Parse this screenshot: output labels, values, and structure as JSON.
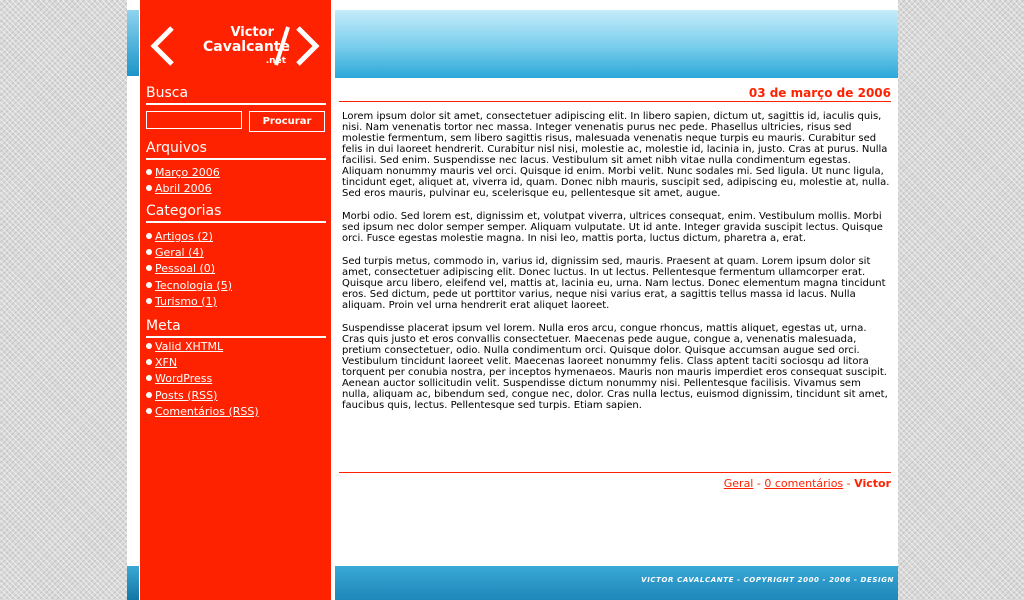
{
  "logo": {
    "line1": "Victor",
    "line2": "Cavalcante",
    "line3": ".net"
  },
  "sidebar": {
    "search_title": "Busca",
    "search_button": "Procurar",
    "archives_title": "Arquivos",
    "archives": [
      "Março 2006",
      "Abril 2006"
    ],
    "categories_title": "Categorias",
    "categories": [
      "Artigos (2)",
      "Geral (4)",
      "Pessoal (0)",
      "Tecnologia (5)",
      "Turismo (1)"
    ],
    "meta_title": "Meta",
    "meta": [
      "Valid XHTML",
      "XFN",
      "WordPress",
      "Posts (RSS)",
      "Comentários (RSS)"
    ]
  },
  "post": {
    "date": "03 de março de 2006",
    "paragraphs": [
      "Lorem ipsum dolor sit amet, consectetuer adipiscing elit. In libero sapien, dictum ut, sagittis id, iaculis quis, nisi. Nam venenatis tortor nec massa. Integer venenatis purus nec pede. Phasellus ultricies, risus sed molestie fermentum, sem libero sagittis risus, malesuada venenatis neque turpis eu mauris. Curabitur sed felis in dui laoreet hendrerit. Curabitur nisl nisi, molestie ac, molestie id, lacinia in, justo. Cras at purus. Nulla facilisi. Sed enim. Suspendisse nec lacus. Vestibulum sit amet nibh vitae nulla condimentum egestas. Aliquam nonummy mauris vel orci. Quisque id enim. Morbi velit. Nunc sodales mi. Sed ligula. Ut nunc ligula, tincidunt eget, aliquet at, viverra id, quam. Donec nibh mauris, suscipit sed, adipiscing eu, molestie at, nulla. Sed eros mauris, pulvinar eu, scelerisque eu, pellentesque sit amet, augue.",
      "Morbi odio. Sed lorem est, dignissim et, volutpat viverra, ultrices consequat, enim. Vestibulum mollis. Morbi sed ipsum nec dolor semper semper. Aliquam vulputate. Ut id ante. Integer gravida suscipit lectus. Quisque orci. Fusce egestas molestie magna. In nisi leo, mattis porta, luctus dictum, pharetra a, erat.",
      "Sed turpis metus, commodo in, varius id, dignissim sed, mauris. Praesent at quam. Lorem ipsum dolor sit amet, consectetuer adipiscing elit. Donec luctus. In ut lectus. Pellentesque fermentum ullamcorper erat. Quisque arcu libero, eleifend vel, mattis at, lacinia eu, urna. Nam lectus. Donec elementum magna tincidunt eros. Sed dictum, pede ut porttitor varius, neque nisi varius erat, a sagittis tellus massa id lacus. Nulla aliquam. Proin vel urna hendrerit erat aliquet laoreet.",
      "Suspendisse placerat ipsum vel lorem. Nulla eros arcu, congue rhoncus, mattis aliquet, egestas ut, urna. Cras quis justo et eros convallis consectetuer. Maecenas pede augue, congue a, venenatis malesuada, pretium consectetuer, odio. Nulla condimentum orci. Quisque dolor. Quisque accumsan augue sed orci. Vestibulum tincidunt laoreet velit. Maecenas laoreet nonummy felis. Class aptent taciti sociosqu ad litora torquent per conubia nostra, per inceptos hymenaeos. Mauris non mauris imperdiet eros consequat suscipit. Aenean auctor sollicitudin velit. Suspendisse dictum nonummy nisi. Pellentesque facilisis. Vivamus sem nulla, aliquam ac, bibendum sed, congue nec, dolor. Cras nulla lectus, euismod dignissim, tincidunt sit amet, faucibus quis, lectus. Pellentesque sed turpis. Etiam sapien."
    ],
    "meta": {
      "category": "Geral",
      "sep1": " - ",
      "comments": "0 comentários",
      "sep2": " - ",
      "author": "Victor"
    }
  },
  "footer": {
    "text": "VICTOR CAVALCANTE - COPYRIGHT 2000 - 2006 - DESIGN"
  },
  "colors": {
    "accent": "#ff2200",
    "header_blue": "#2ca7d8",
    "background": "#ffffff"
  }
}
